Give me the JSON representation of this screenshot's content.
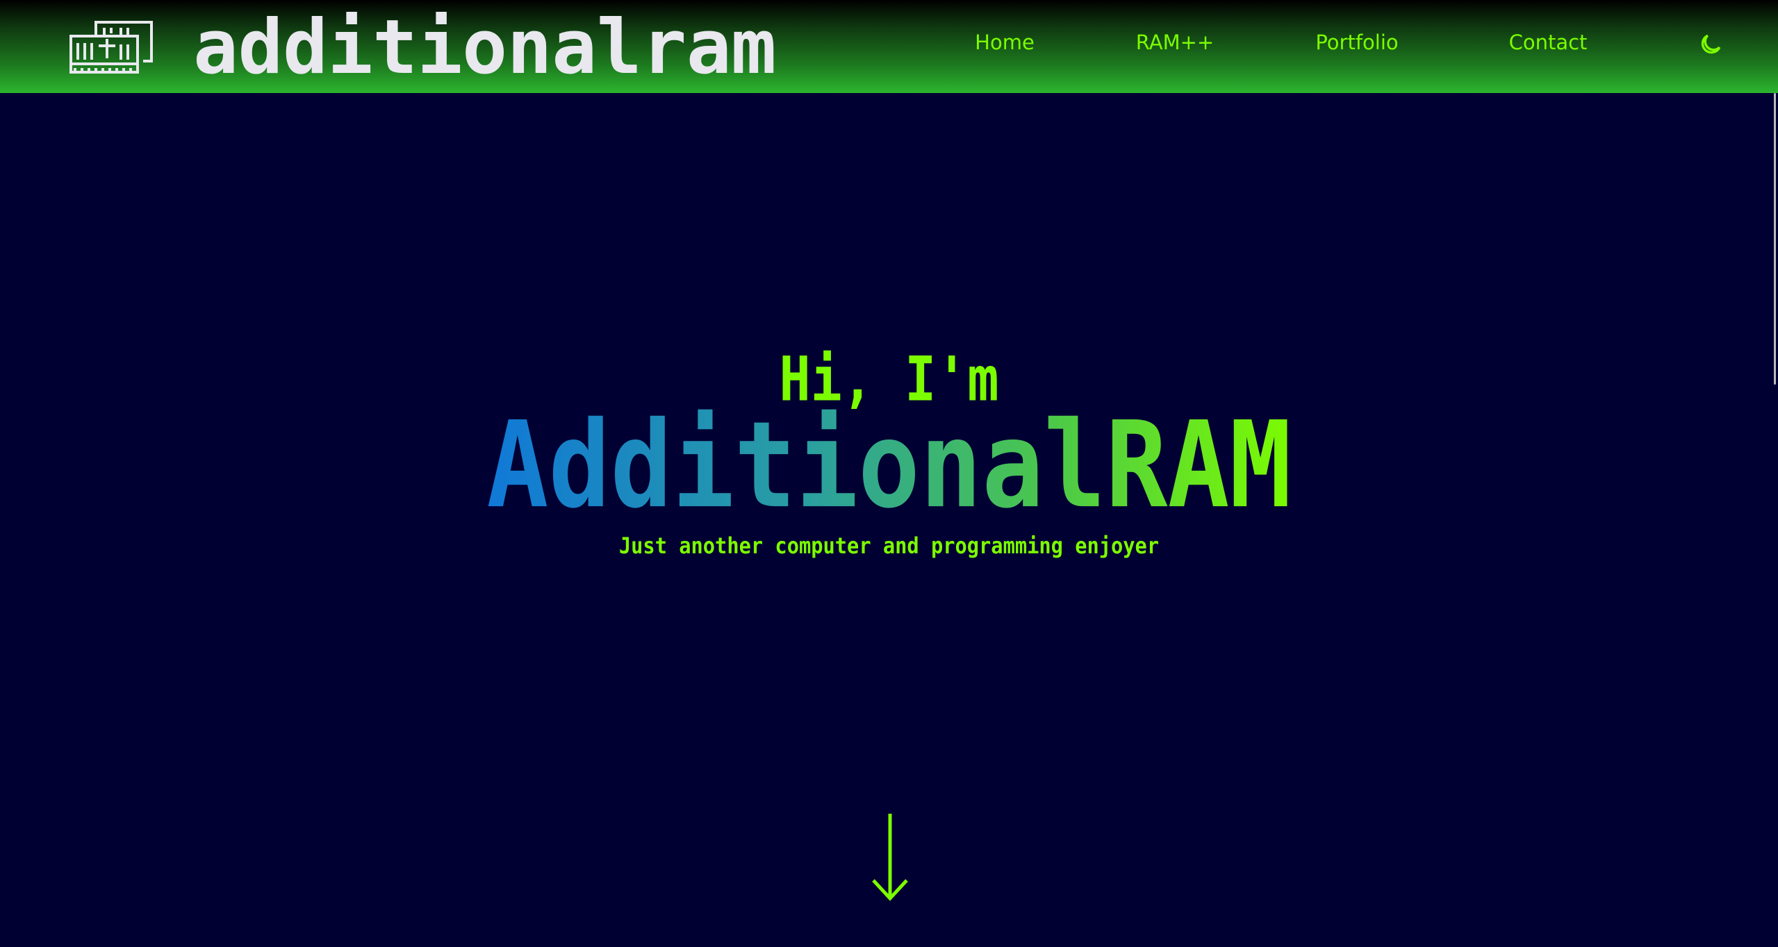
{
  "header": {
    "logo_text": "additionalram",
    "logo_icon": "ram-chip-icon",
    "nav": [
      {
        "label": "Home"
      },
      {
        "label": "RAM++"
      },
      {
        "label": "Portfolio"
      },
      {
        "label": "Contact"
      }
    ],
    "theme_toggle_icon": "moon-icon"
  },
  "hero": {
    "greeting": "Hi, I'm",
    "name": "AdditionalRAM",
    "tagline": "Just another computer and programming enjoyer",
    "scroll_icon": "arrow-down-icon"
  },
  "colors": {
    "background": "#000033",
    "accent": "#7cfc00",
    "header_green": "#2cb52f",
    "name_gradient_start": "#1078d8",
    "name_gradient_end": "#7cfc00"
  }
}
